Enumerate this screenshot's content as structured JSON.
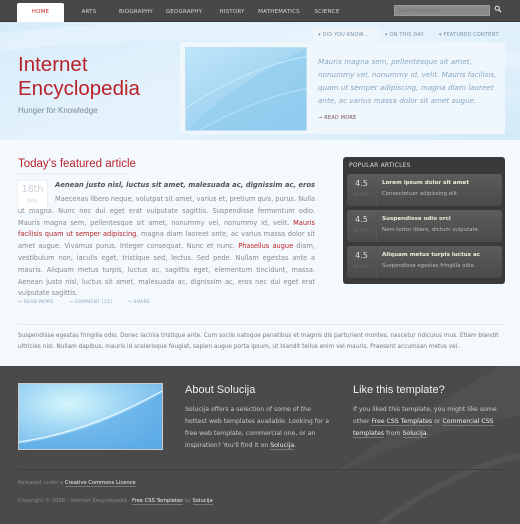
{
  "nav": {
    "items": [
      {
        "label": "HOME",
        "active": true
      },
      {
        "label": "ARTS"
      },
      {
        "label": "BIOGRAPHY"
      },
      {
        "label": "GEOGRAPHY"
      },
      {
        "label": "HISTORY"
      },
      {
        "label": "MATHEMATICS"
      },
      {
        "label": "SCIENCE"
      }
    ],
    "search_placeholder": "Search Keywords",
    "search_icon": "magnifier-icon"
  },
  "header": {
    "title_line1": "Internet",
    "title_line2": "Encyclopedia",
    "slogan": "Hunger for Knowledge"
  },
  "hero": {
    "tabs": [
      {
        "label": "DID YOU KNOW...",
        "active": true
      },
      {
        "label": "ON THIS DAY"
      },
      {
        "label": "FEATURED CONTENT"
      }
    ],
    "text": "Mauris magna sem, pellentesque sit amet, nonummy vel, nonummy id, velit. Mauris facilisis, quam ut semper adipiscing, magna diam laoreet ante, ac varius massa dolor sit amet augue.",
    "read_more": "READ MORE"
  },
  "featured": {
    "title": "Today's featured article",
    "date_day": "18th",
    "date_month": "July",
    "heading": "Aenean justo nisl, luctus sit amet, malesuada ac, dignissim ac, eros",
    "body_1": "Maecenas libero neque, volutpat sit amet, varius et, pretium ",
    "body_em": "quis",
    "body_2": ", purus. Nulla ut magna. Nunc nec dui eget erat vulputate sagittis. Suspendisse fermentum odio. Mauris magna sem, pellentesque sit amet, nonummy vel, nonummy id, velit. ",
    "link_1": "Mauris facilisis quam ut semper adipiscing",
    "body_3": ", magna diam laoreet ante, ac varius massa dolor sit amet augue. Vivamus purus. Integer consequat. Nunc et nunc. ",
    "link_2": "Phasellus augue",
    "body_4": " diam, vestibulum non, iaculis eget, tristique sed, lectus. Sed pede. Nullam egestas ante a mauris. Aliquam metus turpis, luctus ac, sagittis eget, elementum tincidunt, massa. Aenean justo nisl, luctus sit amet, malesuada ac, dignissim ac, eros nec dui eget erat vulputate sagittis.",
    "links": [
      "READ MORE",
      "COMMENT [12]",
      "SHARE"
    ]
  },
  "popular": {
    "title": "POPULAR ARTICLES",
    "rating_label": "RATING",
    "items": [
      {
        "rating": "4.5",
        "title": "Lorem ipsum dolor sit amet",
        "desc": "Consectetuer adipiscing elit."
      },
      {
        "rating": "4.5",
        "title": "Suspendisse odio orci",
        "desc": "Nam tortor libero, dictum vulputate."
      },
      {
        "rating": "4.5",
        "title": "Aliquam metus turpis luctus ac",
        "desc": "Suspendisse egestas fringilla odio."
      }
    ]
  },
  "intro": {
    "text": "Suspendisse egestas fringilla odio. Donec lacinia tristique ante. Cum sociis natoque penatibus et magnis dis parturient montes, nascetur ridiculus mus. Etiam blandit ultricies nisl. Nullam dapibus, mauris id scelerisque feugiat, sapien augue porta ipsum, ut blandit tellus enim vel mauris. Praesent accumsan metus vel."
  },
  "footer": {
    "about_title": "About Solucija",
    "about_text": "Solucija offers a selection of some of the hottest web templates available. Looking for a free web template, commercial one, or an inspiration? You'll find it on ",
    "about_link": "Solucija",
    "like_title": "Like this template?",
    "like_text_1": "If you liked this template, you might like some other ",
    "like_link_1": "Free CSS Templates",
    "like_text_2": " or ",
    "like_link_2": "Commercial CSS templates",
    "like_text_3": " from ",
    "like_link_3": "Solucija",
    "license_text": "Released under a ",
    "license_link": "Creative Commons Licence",
    "copyright_text": "Copyright © 2008 - Internet Encyclopedia - ",
    "copyright_link_1": "Free CSS Templates",
    "copyright_by": " by ",
    "copyright_link_2": "Solucija"
  }
}
